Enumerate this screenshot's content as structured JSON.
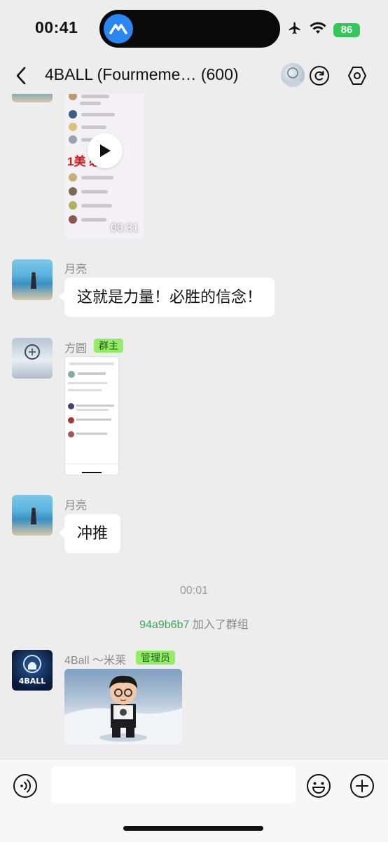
{
  "status_bar": {
    "time": "00:41",
    "battery": "86"
  },
  "nav": {
    "title": "4BALL (Fourmeme… (600)"
  },
  "messages": {
    "video": {
      "duration": "00:31",
      "overlay_text": "1美 必达"
    },
    "m1": {
      "sender": "月亮",
      "text": "这就是力量！必胜的信念！"
    },
    "m2": {
      "sender": "方圆",
      "badge": "群主"
    },
    "m3": {
      "sender": "月亮",
      "text": "冲推"
    },
    "timestamp": "00:01",
    "system": {
      "user": "94a9b6b7",
      "action": " 加入了群组"
    },
    "m4": {
      "sender": "4Ball ～米莱",
      "badge": "管理员",
      "avatar_text": "4BALL"
    }
  },
  "icons": {
    "back": "chevron-left-icon",
    "refresh": "refresh-icon",
    "settings": "settings-icon",
    "voice": "voice-icon",
    "emoji": "emoji-icon",
    "plus": "plus-icon"
  },
  "colors": {
    "badge_bg": "#95ec69",
    "system_user": "#3ba85b",
    "background": "#ededed"
  }
}
